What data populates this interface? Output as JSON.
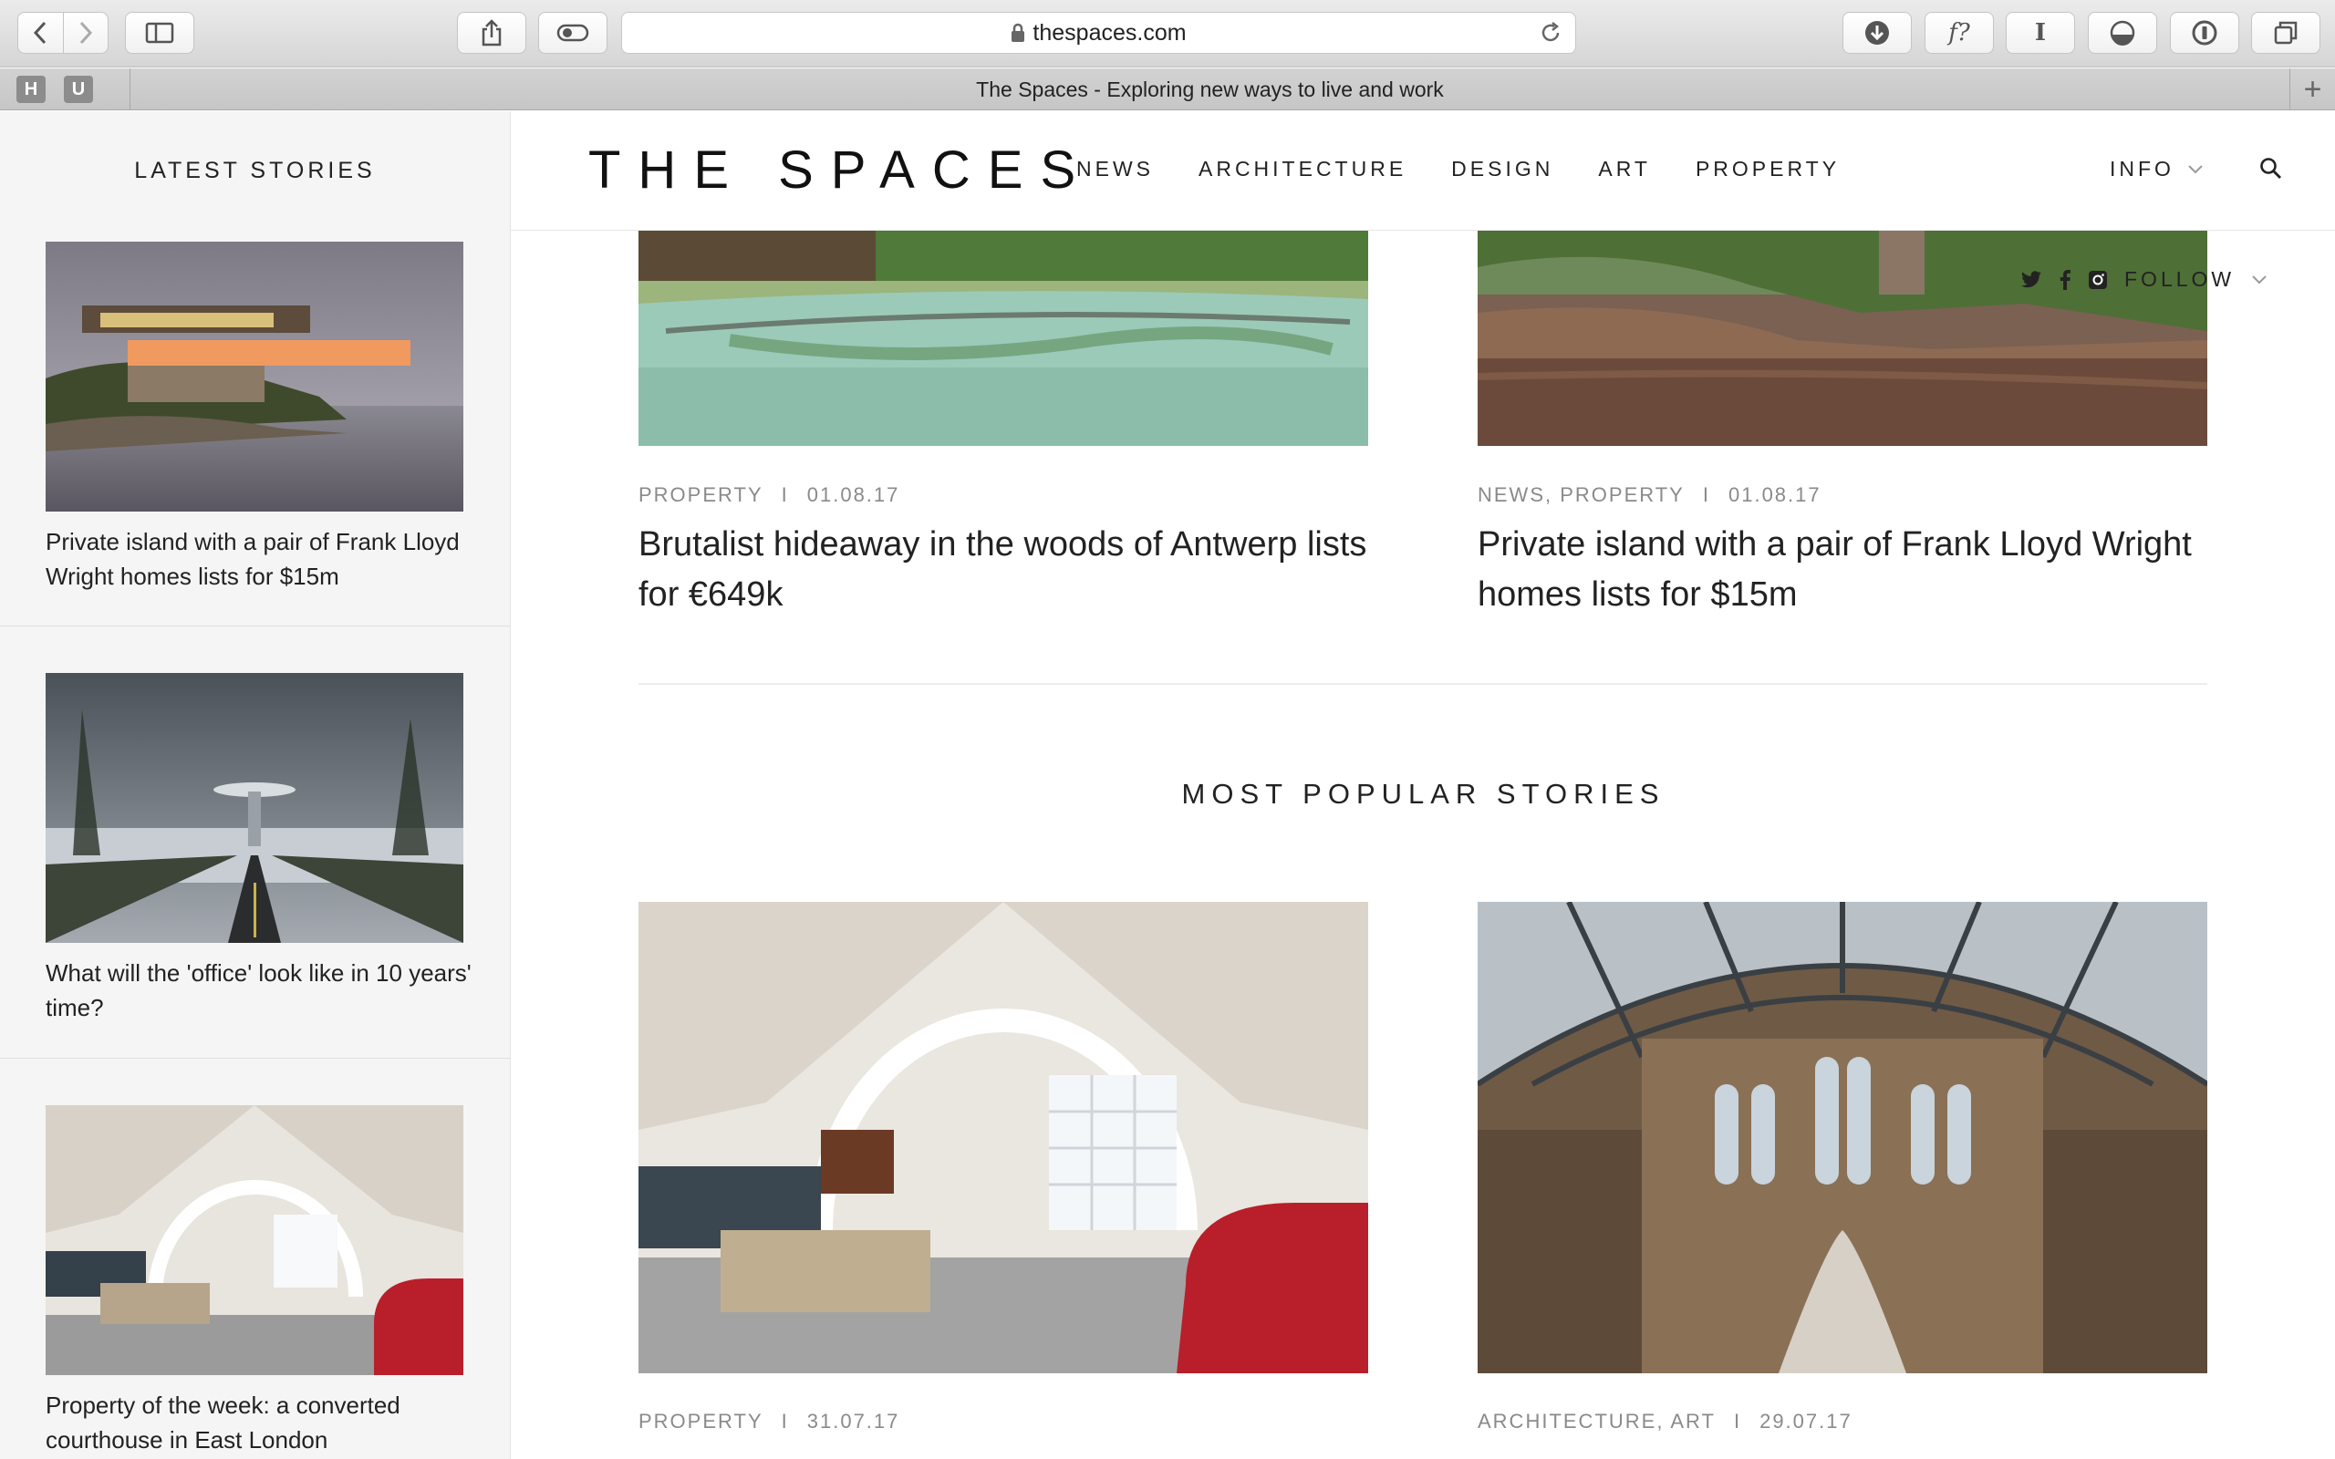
{
  "browser": {
    "url": "thespaces.com",
    "tab_title": "The Spaces - Exploring new ways to live and work",
    "favorites": [
      "H",
      "U"
    ],
    "new_tab": "+"
  },
  "header": {
    "latest_label": "LATEST STORIES",
    "logo": "THE SPACES",
    "nav": [
      "NEWS",
      "ARCHITECTURE",
      "DESIGN",
      "ART",
      "PROPERTY"
    ],
    "info": "INFO"
  },
  "follow": {
    "label": "FOLLOW"
  },
  "sidebar": {
    "items": [
      {
        "title": "Private island with a pair of Frank Lloyd Wright homes lists for $15m"
      },
      {
        "title": "What will the 'office' look like in 10 years' time?"
      },
      {
        "title": "Property of the week: a converted courthouse in East London"
      }
    ]
  },
  "latest_cards": [
    {
      "category": "PROPERTY",
      "date": "01.08.17",
      "title": "Brutalist hideaway in the woods of Antwerp lists for €649k"
    },
    {
      "category": "NEWS, PROPERTY",
      "date": "01.08.17",
      "title": "Private island with a pair of Frank Lloyd Wright homes lists for $15m"
    }
  ],
  "popular": {
    "heading": "MOST POPULAR STORIES",
    "cards": [
      {
        "category": "PROPERTY",
        "date": "31.07.17"
      },
      {
        "category": "ARCHITECTURE, ART",
        "date": "29.07.17"
      }
    ]
  },
  "meta_separator": "I"
}
